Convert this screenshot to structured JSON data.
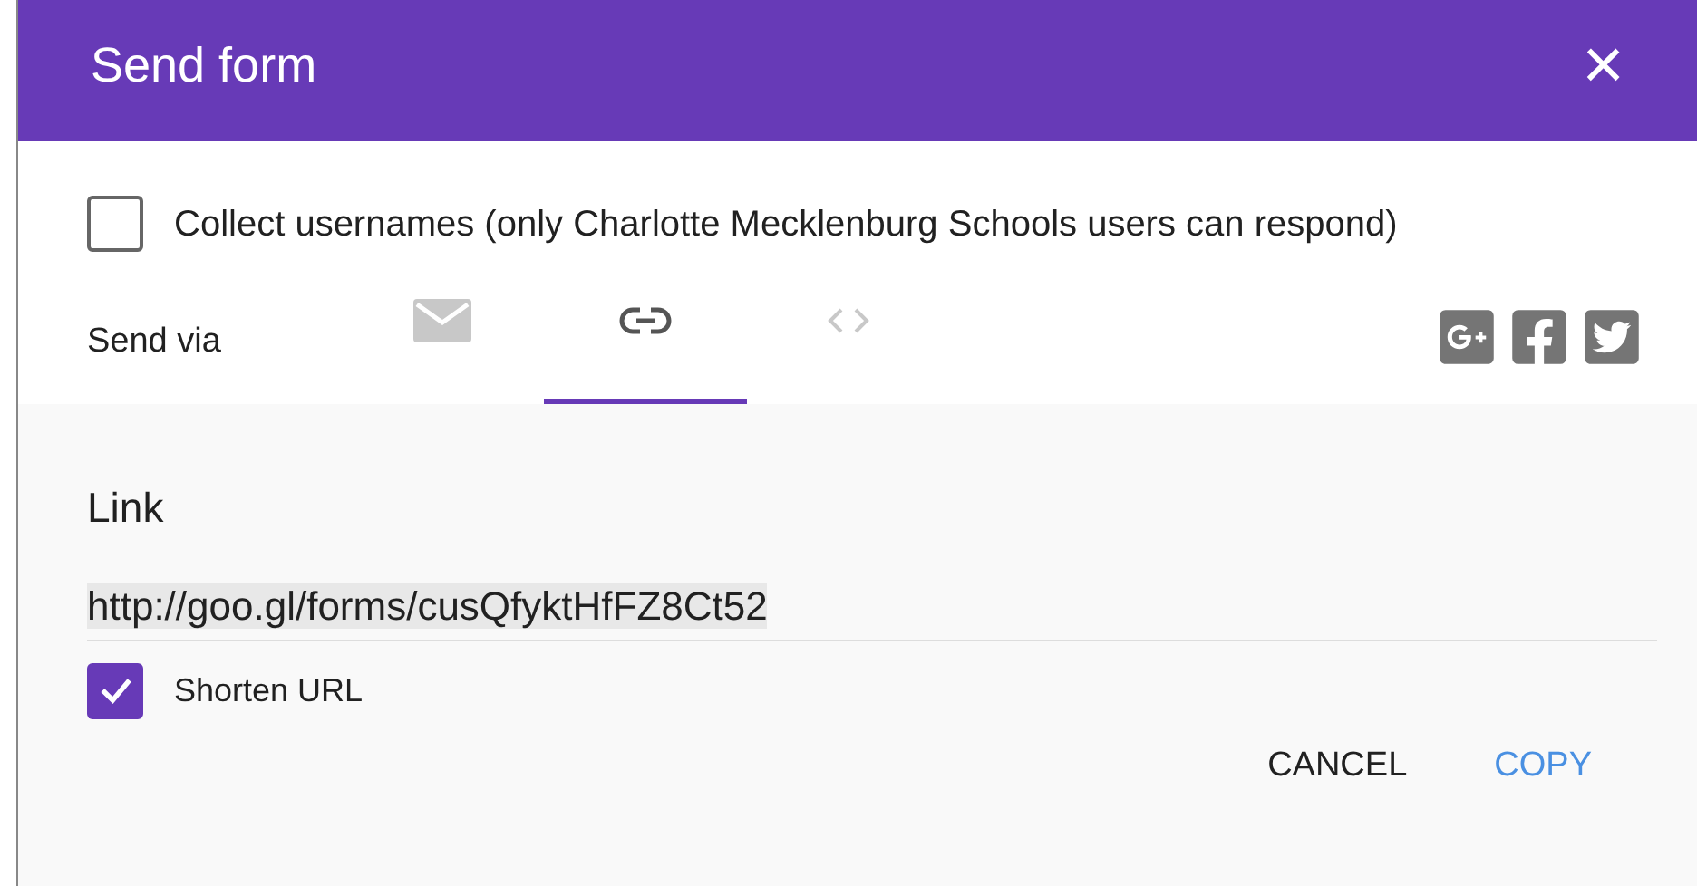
{
  "dialog": {
    "title": "Send form",
    "close": "×"
  },
  "collect_usernames": {
    "label": "Collect usernames (only Charlotte Mecklenburg Schools users can respond)",
    "checked": false
  },
  "send_via": {
    "label": "Send via",
    "tabs": [
      {
        "kind": "email",
        "selected": false
      },
      {
        "kind": "link",
        "selected": true
      },
      {
        "kind": "embed",
        "selected": false
      }
    ],
    "share": [
      {
        "kind": "googleplus"
      },
      {
        "kind": "facebook"
      },
      {
        "kind": "twitter"
      }
    ]
  },
  "link": {
    "heading": "Link",
    "value": "http://goo.gl/forms/cusQfyktHfFZ8Ct52"
  },
  "shorten_url": {
    "label": "Shorten URL",
    "checked": true
  },
  "buttons": [
    {
      "label": "CANCEL",
      "kind": "cancel"
    },
    {
      "label": "COPY",
      "kind": "copy"
    }
  ]
}
